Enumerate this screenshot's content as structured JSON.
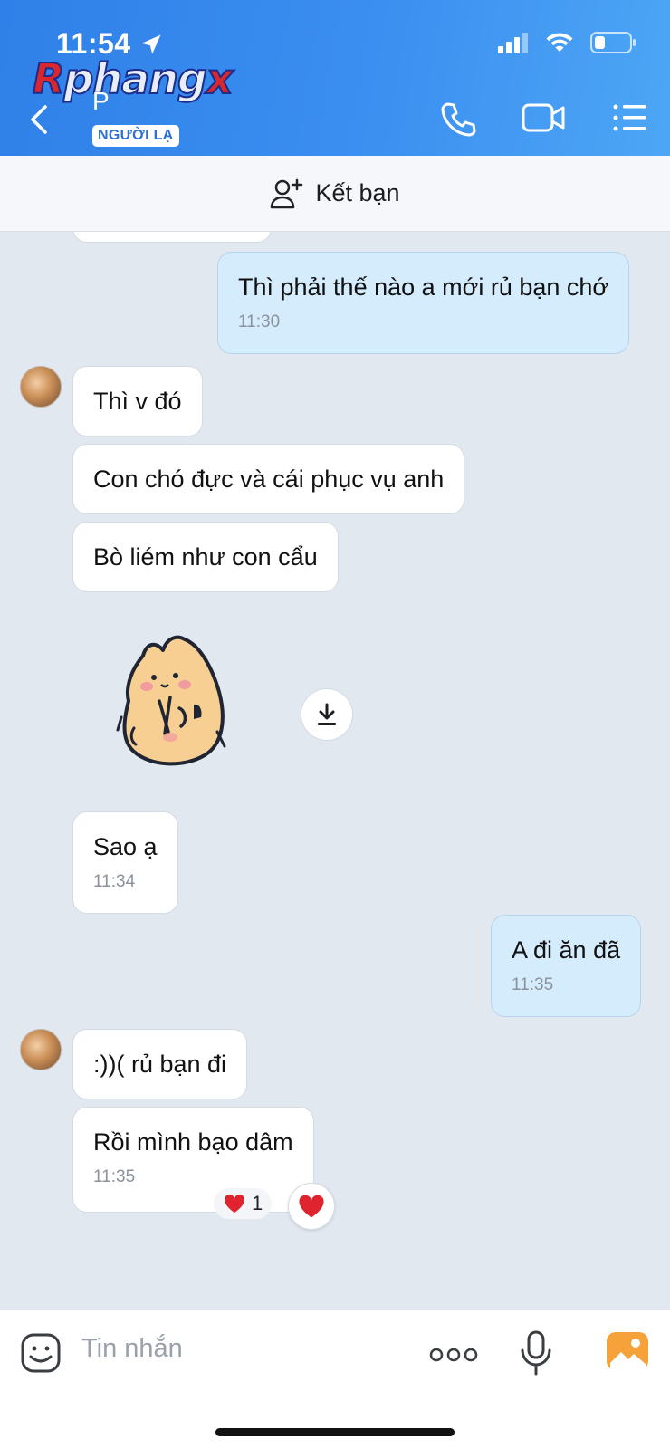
{
  "status": {
    "time": "11:54"
  },
  "watermark": {
    "part1": "R",
    "part2": "phang",
    "part3": "x"
  },
  "header": {
    "contact_name": "P",
    "stranger_badge": "NGƯỜI LẠ"
  },
  "add_friend": {
    "label": "Kết bạn"
  },
  "messages": [
    {
      "dir": "out",
      "text": "Thì phải thế nào a mới rủ bạn chớ",
      "time": "11:30"
    },
    {
      "dir": "in",
      "text": "Thì v đó"
    },
    {
      "dir": "in",
      "text": "Con chó đực và cái phục vụ anh"
    },
    {
      "dir": "in",
      "text": "Bò liém như con cẩu"
    },
    {
      "dir": "in",
      "text": "Sao ạ",
      "time": "11:34"
    },
    {
      "dir": "out",
      "text": "A đi ăn đã",
      "time": "11:35"
    },
    {
      "dir": "in",
      "text": ":))( rủ bạn đi"
    },
    {
      "dir": "in",
      "text": "Rồi mình  bạo dâm",
      "time": "11:35"
    }
  ],
  "reaction": {
    "count": "1"
  },
  "composer": {
    "placeholder": "Tin nhắn"
  },
  "colors": {
    "header_blue": "#2f80e8",
    "bubble_out": "#d5ecfd",
    "chat_bg": "#e2e8f0",
    "heart": "#e0242f"
  }
}
